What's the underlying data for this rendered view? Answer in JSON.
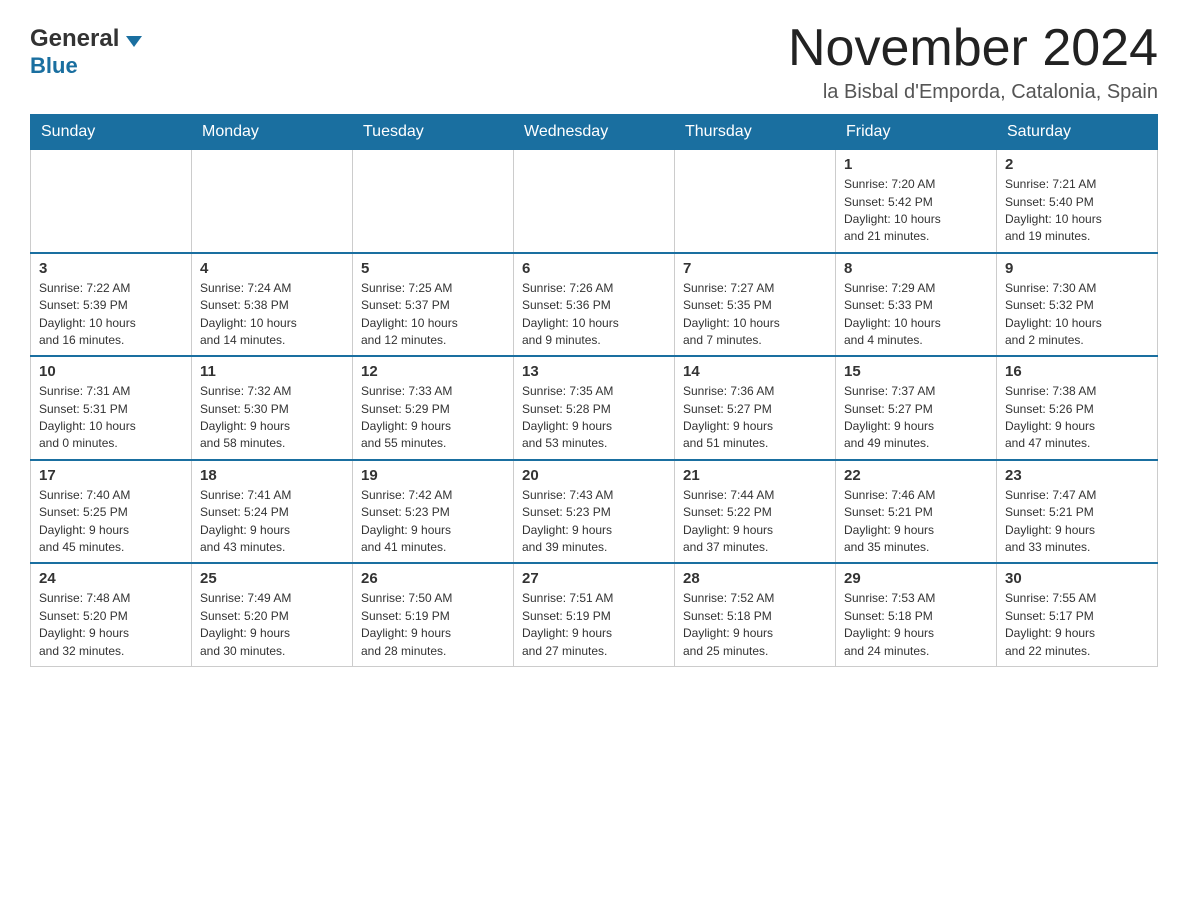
{
  "header": {
    "logo_general": "General",
    "logo_blue": "Blue",
    "month_title": "November 2024",
    "location": "la Bisbal d'Emporda, Catalonia, Spain"
  },
  "weekdays": [
    "Sunday",
    "Monday",
    "Tuesday",
    "Wednesday",
    "Thursday",
    "Friday",
    "Saturday"
  ],
  "weeks": [
    {
      "days": [
        {
          "num": "",
          "info": ""
        },
        {
          "num": "",
          "info": ""
        },
        {
          "num": "",
          "info": ""
        },
        {
          "num": "",
          "info": ""
        },
        {
          "num": "",
          "info": ""
        },
        {
          "num": "1",
          "info": "Sunrise: 7:20 AM\nSunset: 5:42 PM\nDaylight: 10 hours\nand 21 minutes."
        },
        {
          "num": "2",
          "info": "Sunrise: 7:21 AM\nSunset: 5:40 PM\nDaylight: 10 hours\nand 19 minutes."
        }
      ]
    },
    {
      "days": [
        {
          "num": "3",
          "info": "Sunrise: 7:22 AM\nSunset: 5:39 PM\nDaylight: 10 hours\nand 16 minutes."
        },
        {
          "num": "4",
          "info": "Sunrise: 7:24 AM\nSunset: 5:38 PM\nDaylight: 10 hours\nand 14 minutes."
        },
        {
          "num": "5",
          "info": "Sunrise: 7:25 AM\nSunset: 5:37 PM\nDaylight: 10 hours\nand 12 minutes."
        },
        {
          "num": "6",
          "info": "Sunrise: 7:26 AM\nSunset: 5:36 PM\nDaylight: 10 hours\nand 9 minutes."
        },
        {
          "num": "7",
          "info": "Sunrise: 7:27 AM\nSunset: 5:35 PM\nDaylight: 10 hours\nand 7 minutes."
        },
        {
          "num": "8",
          "info": "Sunrise: 7:29 AM\nSunset: 5:33 PM\nDaylight: 10 hours\nand 4 minutes."
        },
        {
          "num": "9",
          "info": "Sunrise: 7:30 AM\nSunset: 5:32 PM\nDaylight: 10 hours\nand 2 minutes."
        }
      ]
    },
    {
      "days": [
        {
          "num": "10",
          "info": "Sunrise: 7:31 AM\nSunset: 5:31 PM\nDaylight: 10 hours\nand 0 minutes."
        },
        {
          "num": "11",
          "info": "Sunrise: 7:32 AM\nSunset: 5:30 PM\nDaylight: 9 hours\nand 58 minutes."
        },
        {
          "num": "12",
          "info": "Sunrise: 7:33 AM\nSunset: 5:29 PM\nDaylight: 9 hours\nand 55 minutes."
        },
        {
          "num": "13",
          "info": "Sunrise: 7:35 AM\nSunset: 5:28 PM\nDaylight: 9 hours\nand 53 minutes."
        },
        {
          "num": "14",
          "info": "Sunrise: 7:36 AM\nSunset: 5:27 PM\nDaylight: 9 hours\nand 51 minutes."
        },
        {
          "num": "15",
          "info": "Sunrise: 7:37 AM\nSunset: 5:27 PM\nDaylight: 9 hours\nand 49 minutes."
        },
        {
          "num": "16",
          "info": "Sunrise: 7:38 AM\nSunset: 5:26 PM\nDaylight: 9 hours\nand 47 minutes."
        }
      ]
    },
    {
      "days": [
        {
          "num": "17",
          "info": "Sunrise: 7:40 AM\nSunset: 5:25 PM\nDaylight: 9 hours\nand 45 minutes."
        },
        {
          "num": "18",
          "info": "Sunrise: 7:41 AM\nSunset: 5:24 PM\nDaylight: 9 hours\nand 43 minutes."
        },
        {
          "num": "19",
          "info": "Sunrise: 7:42 AM\nSunset: 5:23 PM\nDaylight: 9 hours\nand 41 minutes."
        },
        {
          "num": "20",
          "info": "Sunrise: 7:43 AM\nSunset: 5:23 PM\nDaylight: 9 hours\nand 39 minutes."
        },
        {
          "num": "21",
          "info": "Sunrise: 7:44 AM\nSunset: 5:22 PM\nDaylight: 9 hours\nand 37 minutes."
        },
        {
          "num": "22",
          "info": "Sunrise: 7:46 AM\nSunset: 5:21 PM\nDaylight: 9 hours\nand 35 minutes."
        },
        {
          "num": "23",
          "info": "Sunrise: 7:47 AM\nSunset: 5:21 PM\nDaylight: 9 hours\nand 33 minutes."
        }
      ]
    },
    {
      "days": [
        {
          "num": "24",
          "info": "Sunrise: 7:48 AM\nSunset: 5:20 PM\nDaylight: 9 hours\nand 32 minutes."
        },
        {
          "num": "25",
          "info": "Sunrise: 7:49 AM\nSunset: 5:20 PM\nDaylight: 9 hours\nand 30 minutes."
        },
        {
          "num": "26",
          "info": "Sunrise: 7:50 AM\nSunset: 5:19 PM\nDaylight: 9 hours\nand 28 minutes."
        },
        {
          "num": "27",
          "info": "Sunrise: 7:51 AM\nSunset: 5:19 PM\nDaylight: 9 hours\nand 27 minutes."
        },
        {
          "num": "28",
          "info": "Sunrise: 7:52 AM\nSunset: 5:18 PM\nDaylight: 9 hours\nand 25 minutes."
        },
        {
          "num": "29",
          "info": "Sunrise: 7:53 AM\nSunset: 5:18 PM\nDaylight: 9 hours\nand 24 minutes."
        },
        {
          "num": "30",
          "info": "Sunrise: 7:55 AM\nSunset: 5:17 PM\nDaylight: 9 hours\nand 22 minutes."
        }
      ]
    }
  ]
}
